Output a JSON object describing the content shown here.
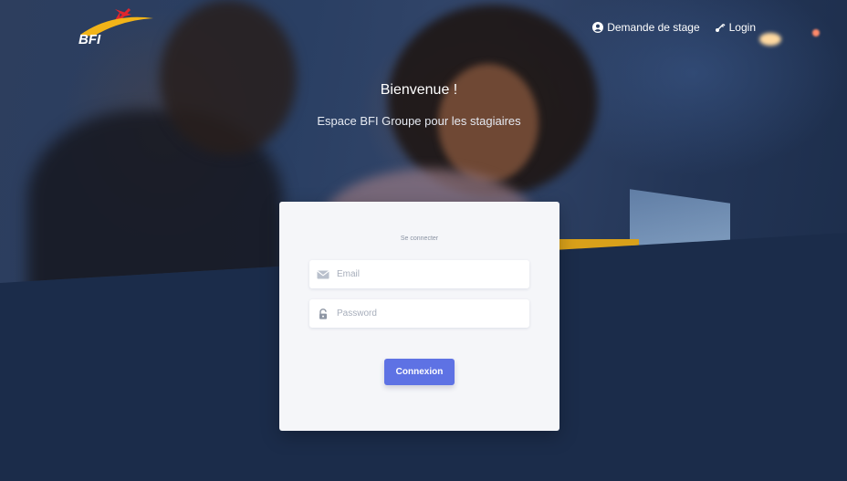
{
  "header": {
    "logo_text": "BFI",
    "nav": [
      {
        "label": "Demande de stage",
        "icon": "user-circle-icon"
      },
      {
        "label": "Login",
        "icon": "key-icon"
      }
    ]
  },
  "hero": {
    "title": "Bienvenue !",
    "subtitle": "Espace BFI Groupe pour les stagiaires"
  },
  "login": {
    "title": "Se connecter",
    "email": {
      "placeholder": "Email",
      "value": "",
      "icon": "envelope-icon"
    },
    "password": {
      "placeholder": "Password",
      "value": "",
      "icon": "lock-icon"
    },
    "submit_label": "Connexion"
  },
  "colors": {
    "accent": "#5e72e4",
    "background": "#1b2c4a",
    "card": "#f5f6f9",
    "logo_red": "#e0262e",
    "logo_yellow": "#f2b418"
  }
}
